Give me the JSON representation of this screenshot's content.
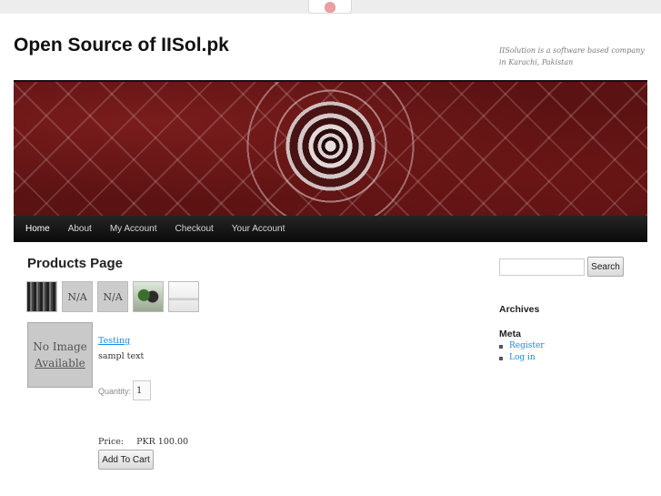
{
  "site": {
    "title": "Open Source of IISol.pk",
    "description": "IISolution is a software based company in Karachi, Pakistan"
  },
  "nav": {
    "items": [
      {
        "label": "Home",
        "active": true
      },
      {
        "label": "About"
      },
      {
        "label": "My Account"
      },
      {
        "label": "Checkout"
      },
      {
        "label": "Your Account"
      }
    ]
  },
  "content": {
    "page_title": "Products Page",
    "thumbnails": [
      "",
      "N/A",
      "N/A",
      "",
      ""
    ],
    "product": {
      "no_image_line1": "No Image",
      "no_image_line2": "Available",
      "name": "Testing",
      "description": "sampl text",
      "quantity_label": "Quantity:",
      "quantity_value": "1",
      "price_label": "Price:",
      "price_value": "PKR 100.00",
      "add_to_cart_label": "Add To Cart"
    }
  },
  "sidebar": {
    "search_placeholder": "",
    "search_button": "Search",
    "archives_title": "Archives",
    "meta_title": "Meta",
    "meta_links": [
      "Register",
      "Log in"
    ]
  }
}
